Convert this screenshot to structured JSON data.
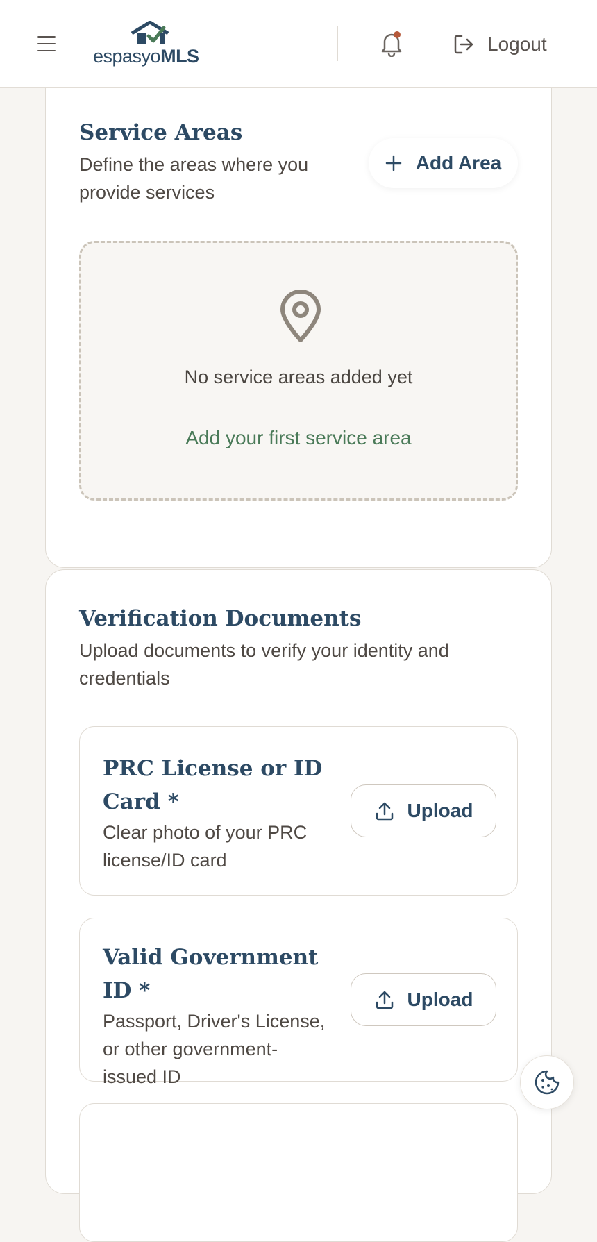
{
  "header": {
    "logo_prefix": "espasyo",
    "logo_suffix": "MLS",
    "logout_label": "Logout",
    "has_notification": true
  },
  "service_areas": {
    "title": "Service Areas",
    "subtitle_line1": "Define the areas where you",
    "subtitle_line2": "provide services",
    "add_button_label": "Add Area",
    "empty_message": "No service areas added yet",
    "empty_cta": "Add your first service area"
  },
  "verification": {
    "title": "Verification Documents",
    "subtitle_line1": "Upload documents to verify your identity and",
    "subtitle_line2": "credentials",
    "documents": [
      {
        "title_line1": "PRC License or ID",
        "title_line2": "Card *",
        "desc_line1": "Clear photo of your PRC",
        "desc_line2": "license/ID card",
        "upload_label": "Upload"
      },
      {
        "title_line1": "Valid Government ID *",
        "desc_line1": "Passport, Driver's License,",
        "desc_line2": "or other government-",
        "desc_line3": "issued ID",
        "upload_label": "Upload"
      }
    ]
  },
  "colors": {
    "brand_navy": "#2d4a64",
    "brand_green": "#4a7a58",
    "notification_dot": "#b5593a",
    "page_bg": "#f7f5f2"
  },
  "icons": {
    "menu": "hamburger-icon",
    "notifications": "bell-icon",
    "logout": "logout-icon",
    "add": "plus-icon",
    "empty_state": "map-pin-icon",
    "upload": "upload-icon",
    "cookie": "cookie-icon"
  }
}
